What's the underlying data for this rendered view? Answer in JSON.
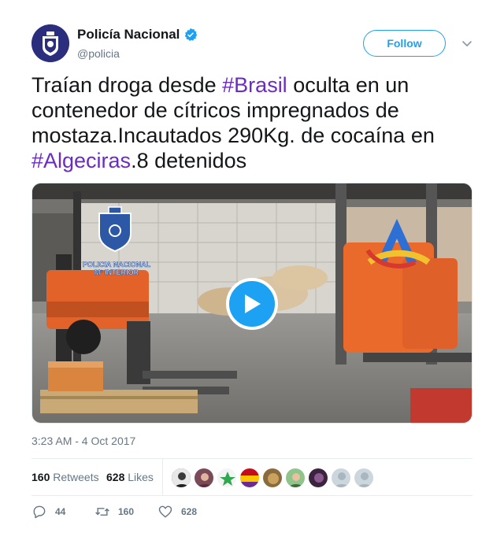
{
  "account": {
    "display_name": "Policía Nacional",
    "handle": "@policia",
    "verified": true,
    "follow_label": "Follow"
  },
  "tweet": {
    "segments": [
      {
        "text": "Traían droga desde ",
        "type": "text"
      },
      {
        "text": "#Brasil",
        "type": "hashtag"
      },
      {
        "text": " oculta en un contenedor de cítricos impregnados de mostaza.Incautados 290Kg. de cocaína en ",
        "type": "text"
      },
      {
        "text": "#Algeciras",
        "type": "hashtag"
      },
      {
        "text": ".8 detenidos",
        "type": "text"
      }
    ]
  },
  "media": {
    "type": "video",
    "watermark_line1": "POLICIA NACIONAL",
    "watermark_line2": "Mº INTERIOR"
  },
  "timestamp": "3:23 AM - 4 Oct 2017",
  "stats": {
    "retweets_count": "160",
    "retweets_label": "Retweets",
    "likes_count": "628",
    "likes_label": "Likes"
  },
  "actions": {
    "reply_count": "44",
    "retweet_count": "160",
    "like_count": "628"
  },
  "colors": {
    "accent": "#1da1f2",
    "hashtag": "#6a2cc1",
    "text": "#14171a",
    "muted": "#657786"
  }
}
